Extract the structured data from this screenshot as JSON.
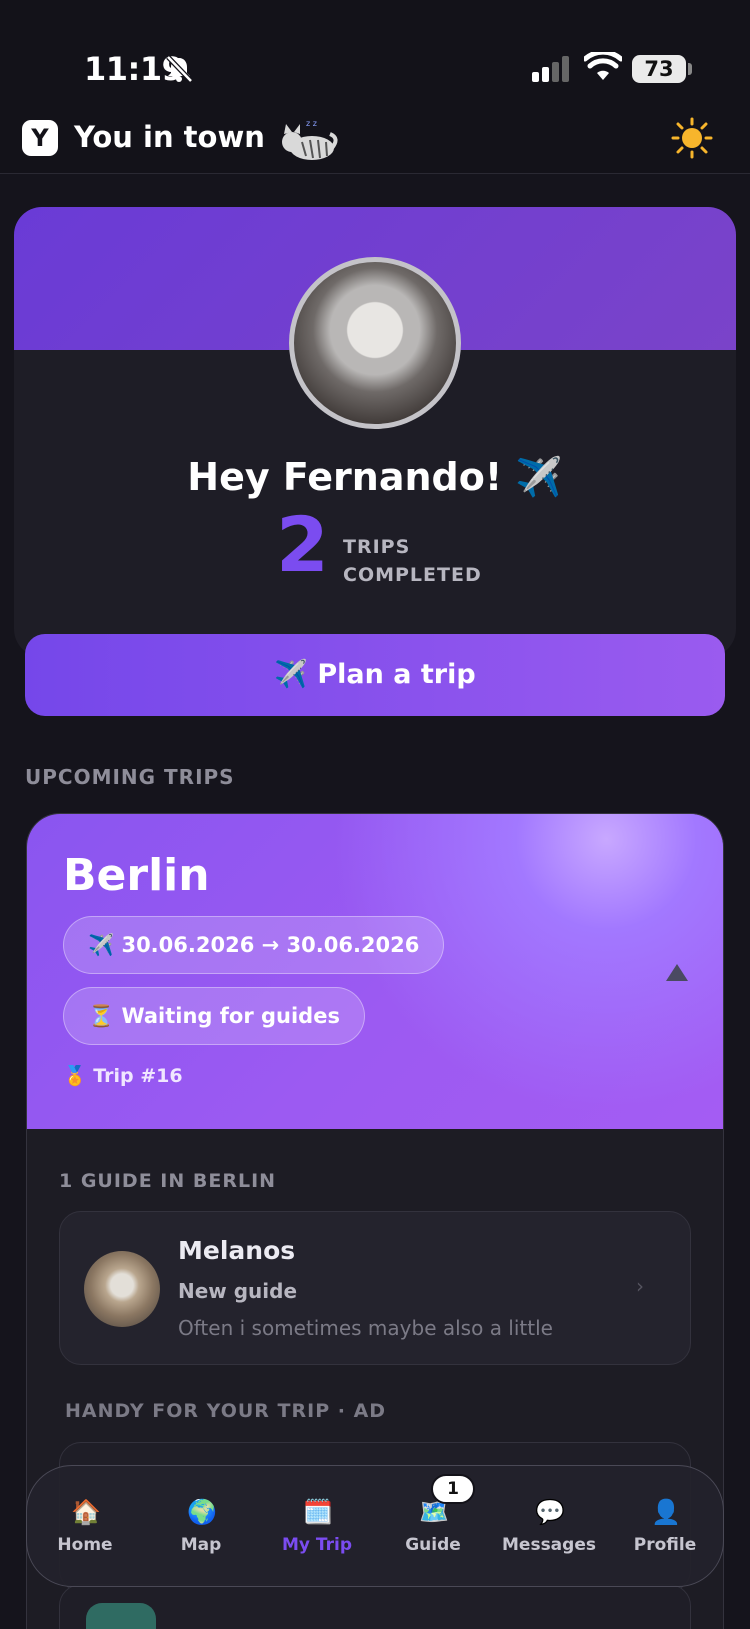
{
  "status_bar": {
    "time": "11:19",
    "battery": "73"
  },
  "header": {
    "logo_letter": "Y",
    "title": "You in town"
  },
  "profile": {
    "greeting": "Hey Fernando! ✈️",
    "trips_count": "2",
    "trips_label_line1": "TRIPS",
    "trips_label_line2": "COMPLETED"
  },
  "plan_button": {
    "label": "✈️ Plan a trip"
  },
  "upcoming": {
    "section_label": "UPCOMING TRIPS",
    "trip": {
      "city": "Berlin",
      "dates": "✈️ 30.06.2026 → 30.06.2026",
      "status": "⏳ Waiting for guides",
      "trip_number": "🏅 Trip #16",
      "guides_label": "1 GUIDE IN BERLIN",
      "guide": {
        "name": "Melanos",
        "role": "New guide",
        "bio": "Often i sometimes maybe also a little"
      },
      "ad_label": "HANDY FOR YOUR TRIP · AD"
    }
  },
  "tabs": [
    {
      "label": "Home",
      "icon": "🏠",
      "icon_name": "home-icon"
    },
    {
      "label": "Map",
      "icon": "🌍",
      "icon_name": "globe-icon"
    },
    {
      "label": "My Trip",
      "icon": "🗓️",
      "icon_name": "calendar-icon",
      "active": true
    },
    {
      "label": "Guide",
      "icon": "🗺️",
      "icon_name": "map-icon",
      "badge": "1"
    },
    {
      "label": "Messages",
      "icon": "💬",
      "icon_name": "speech-bubble-icon"
    },
    {
      "label": "Profile",
      "icon": "👤",
      "icon_name": "person-icon"
    }
  ],
  "colors": {
    "accent": "#7b4cf0",
    "background": "#15141c",
    "card": "#1e1d26"
  }
}
